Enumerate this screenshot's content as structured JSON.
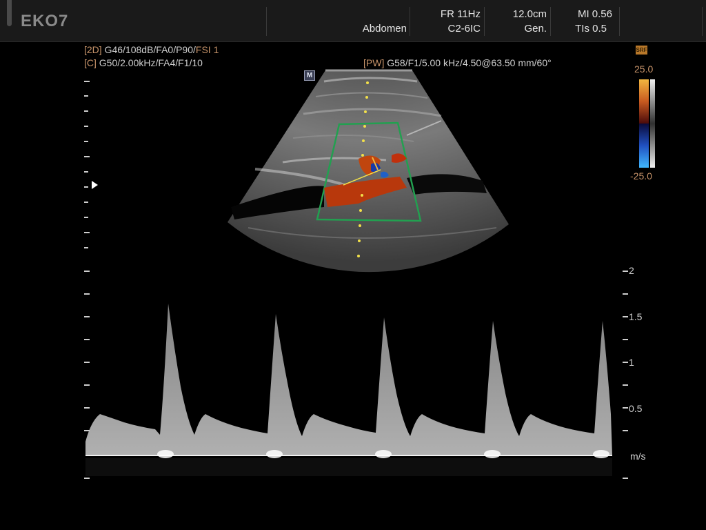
{
  "topbar": {
    "brand": "EKO7",
    "preset": "Abdomen",
    "frame_rate": "FR 11Hz",
    "probe": "C2-6IC",
    "depth": "12.0cm",
    "mode": "Gen.",
    "mi": "MI 0.56",
    "tis": "TIs 0.5"
  },
  "params": {
    "line_2d_tag": "[2D]",
    "line_2d_text": " G46/108dB/FA0/P90/",
    "line_2d_fsi": "FSI 1",
    "line_c_tag": "[C]",
    "line_c_text": " G50/2.00kHz/FA4/F1/10",
    "line_pw_tag": "[PW]",
    "line_pw_text": " G58/F1/5.00 kHz/4.50@63.50 mm/60°"
  },
  "mode_icon": "M",
  "color_scale": {
    "icon": "SRF",
    "max": "25.0",
    "min": "-25.0",
    "colors": {
      "top": "#f2b640",
      "mid_high": "#7a1010",
      "mid_low": "#102060",
      "bottom": "#40b8ff"
    }
  },
  "doppler_scale": {
    "ticks": [
      "2",
      "1.5",
      "1",
      "0.5"
    ],
    "unit": "m/s"
  }
}
